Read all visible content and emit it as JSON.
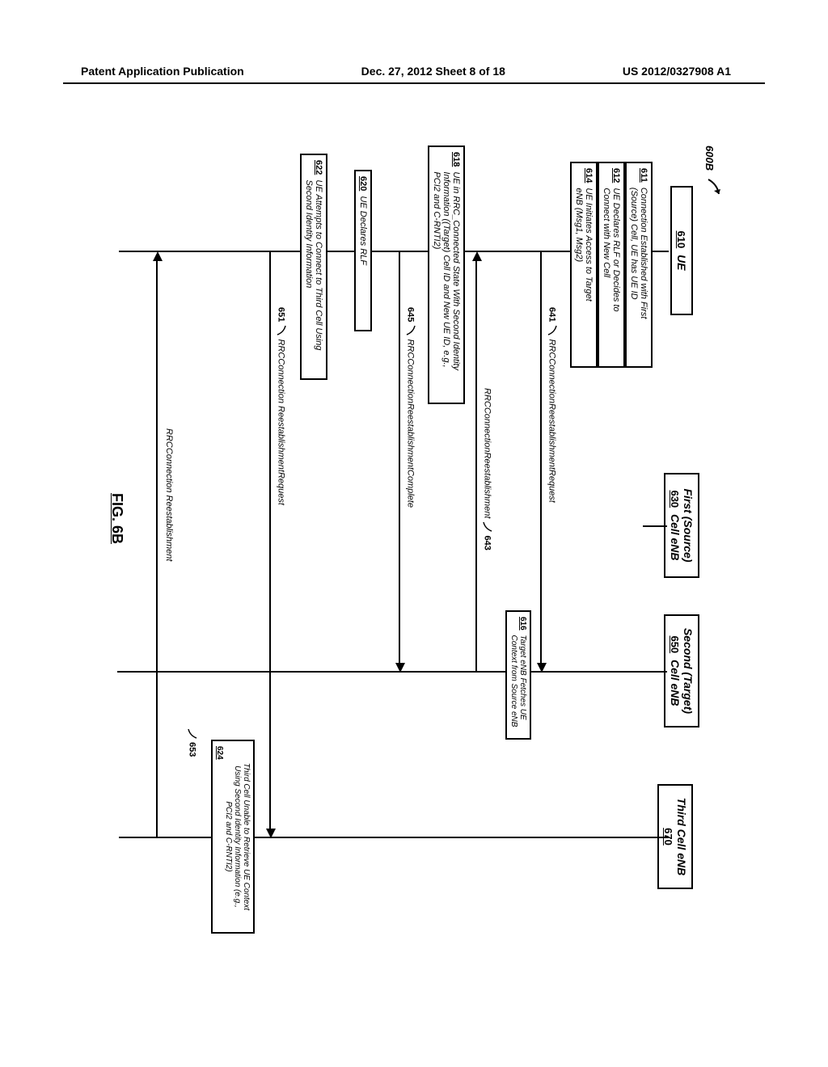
{
  "header": {
    "left": "Patent Application Publication",
    "center": "Dec. 27, 2012  Sheet 8 of 18",
    "right": "US 2012/0327908 A1"
  },
  "figure": {
    "number": "600B",
    "label": "FIG. 6B"
  },
  "actors": {
    "ue": {
      "title": "UE",
      "ref": "610"
    },
    "source": {
      "title1": "First (Source)",
      "title2": "Cell eNB",
      "ref": "630"
    },
    "target": {
      "title1": "Second (Target)",
      "title2": "Cell eNB",
      "ref": "650"
    },
    "third": {
      "title": "Third Cell eNB",
      "ref": "670"
    }
  },
  "events": {
    "e611": {
      "ref": "611",
      "text1": "Connection Established with First",
      "text2": "(Source) Cell, UE has UE ID"
    },
    "e612": {
      "ref": "612",
      "text1": "UE Declares RLF or Decides to",
      "text2": "Connect with New Cell"
    },
    "e614": {
      "ref": "614",
      "text1": "UE Initiates Access to Target",
      "text2": "eNB (Msg1, Msg2)"
    },
    "e616": {
      "ref": "616",
      "text1": "Target eNB Fetches UE",
      "text2": "Context from Source eNB"
    },
    "e618": {
      "ref": "618",
      "text1": "UE in RRC_Connected State With Second Identity",
      "text2": "Information ((Target) Cell ID and New UE ID, e.g.,",
      "text3": "PCI2 and C-RNTI2)"
    },
    "e620": {
      "ref": "620",
      "text": "UE Declares RLF"
    },
    "e622": {
      "ref": "622",
      "text1": "UE Attempts to Connect to Third Cell Using",
      "text2": "Second Identity Information"
    },
    "e624": {
      "ref": "624",
      "text1": "Third Cell Unable to Retrieve UE Context",
      "text2": "Using Second Identity Information (e.g.,",
      "text3": "PCI2 and C-RNTI2)"
    }
  },
  "messages": {
    "m641": {
      "ref": "641",
      "text": "RRCConnectionReestablishmentRequest"
    },
    "m643": {
      "ref": "643",
      "text": "RRCConnectionReestablishment"
    },
    "m645": {
      "ref": "645",
      "text": "RRCConnectionReestablishmentComplete"
    },
    "m651": {
      "ref": "651",
      "text": "RRCConnection ReestablishmentRequest"
    },
    "m653": {
      "ref": "653",
      "text": "RRCConnection Reestablishment"
    }
  }
}
